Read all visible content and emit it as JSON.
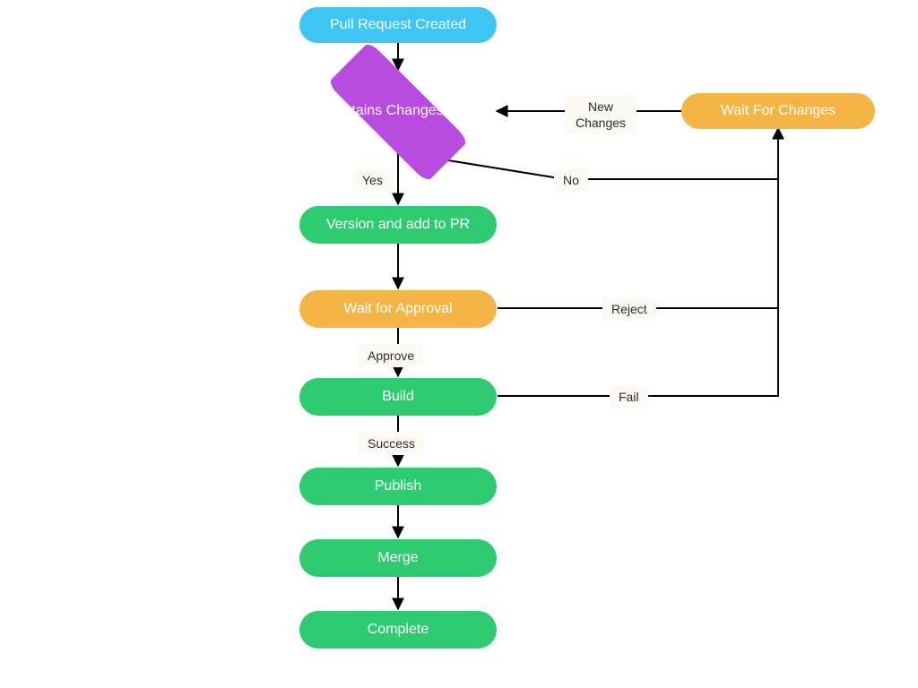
{
  "nodes": {
    "start": {
      "label": "Pull Request Created",
      "type": "start",
      "color": "blue"
    },
    "decision": {
      "label": "Contains Changesets?",
      "type": "decision",
      "color": "purple"
    },
    "wait_changes": {
      "label": "Wait For Changes",
      "type": "process",
      "color": "orange"
    },
    "version": {
      "label": "Version and add to PR",
      "type": "process",
      "color": "green"
    },
    "wait_approval": {
      "label": "Wait for Approval",
      "type": "process",
      "color": "orange"
    },
    "build": {
      "label": "Build",
      "type": "process",
      "color": "green"
    },
    "publish": {
      "label": "Publish",
      "type": "process",
      "color": "green"
    },
    "merge": {
      "label": "Merge",
      "type": "process",
      "color": "green"
    },
    "complete": {
      "label": "Complete",
      "type": "terminal",
      "color": "green"
    }
  },
  "edges": {
    "start_to_decision": {
      "from": "start",
      "to": "decision"
    },
    "decision_yes": {
      "from": "decision",
      "to": "version",
      "label": "Yes"
    },
    "decision_no": {
      "from": "decision",
      "to": "wait_changes",
      "label": "No"
    },
    "wait_to_decision": {
      "from": "wait_changes",
      "to": "decision",
      "label": "New Changes"
    },
    "version_to_approval": {
      "from": "version",
      "to": "wait_approval"
    },
    "approval_approve": {
      "from": "wait_approval",
      "to": "build",
      "label": "Approve"
    },
    "approval_reject": {
      "from": "wait_approval",
      "to": "wait_changes",
      "label": "Reject"
    },
    "build_success": {
      "from": "build",
      "to": "publish",
      "label": "Success"
    },
    "build_fail": {
      "from": "build",
      "to": "wait_changes",
      "label": "Fail"
    },
    "publish_to_merge": {
      "from": "publish",
      "to": "merge"
    },
    "merge_to_complete": {
      "from": "merge",
      "to": "complete"
    }
  }
}
